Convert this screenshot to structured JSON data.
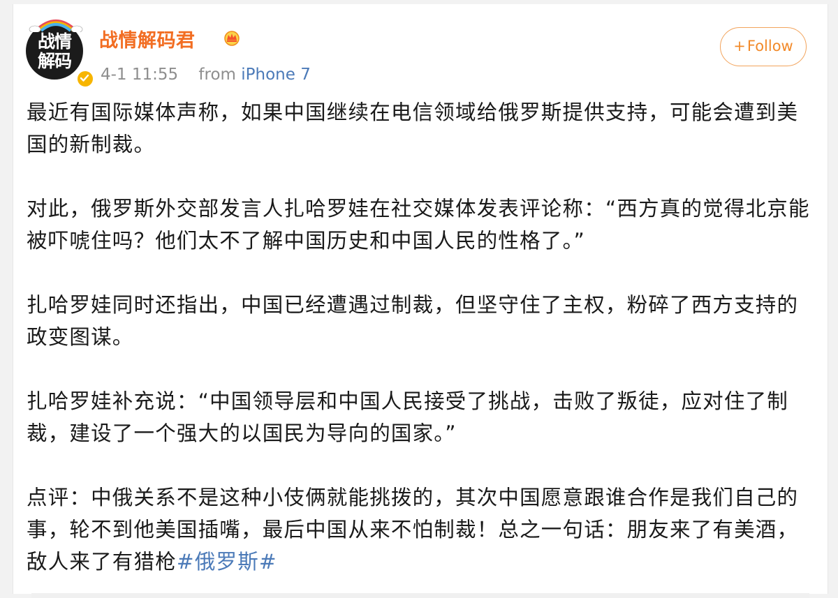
{
  "post": {
    "author": {
      "name": "战情解码君",
      "avatar_text_line1": "战情",
      "avatar_text_line2": "解码",
      "verified_icon": "verified-badge-icon",
      "vip_icon": "crown-icon"
    },
    "meta": {
      "time": "4-1 11:55",
      "from_label": "from",
      "device": "iPhone 7"
    },
    "follow": {
      "plus": "+",
      "label": "Follow"
    },
    "paragraphs": [
      "最近有国际媒体声称，如果中国继续在电信领域给俄罗斯提供支持，可能会遭到美国的新制裁。",
      "对此，俄罗斯外交部发言人扎哈罗娃在社交媒体发表评论称：“西方真的觉得北京能被吓唬住吗？他们太不了解中国历史和中国人民的性格了。”",
      "扎哈罗娃同时还指出，中国已经遭遇过制裁，但坚守住了主权，粉碎了西方支持的政变图谋。",
      "扎哈罗娃补充说：“中国领导层和中国人民接受了挑战，击败了叛徒，应对住了制裁，建设了一个强大的以国民为导向的国家。”"
    ],
    "last_paragraph": "点评：中俄关系不是这种小伎俩就能挑拨的，其次中国愿意跟谁合作是我们自己的事，轮不到他美国插嘴，最后中国从来不怕制裁！总之一句话：朋友来了有美酒，敌人来了有猎枪",
    "hashtag": "#俄罗斯#"
  },
  "colors": {
    "username": "#f26d22",
    "link": "#4b7ab8",
    "follow": "#f28a2a",
    "badge": "#f7b500"
  }
}
